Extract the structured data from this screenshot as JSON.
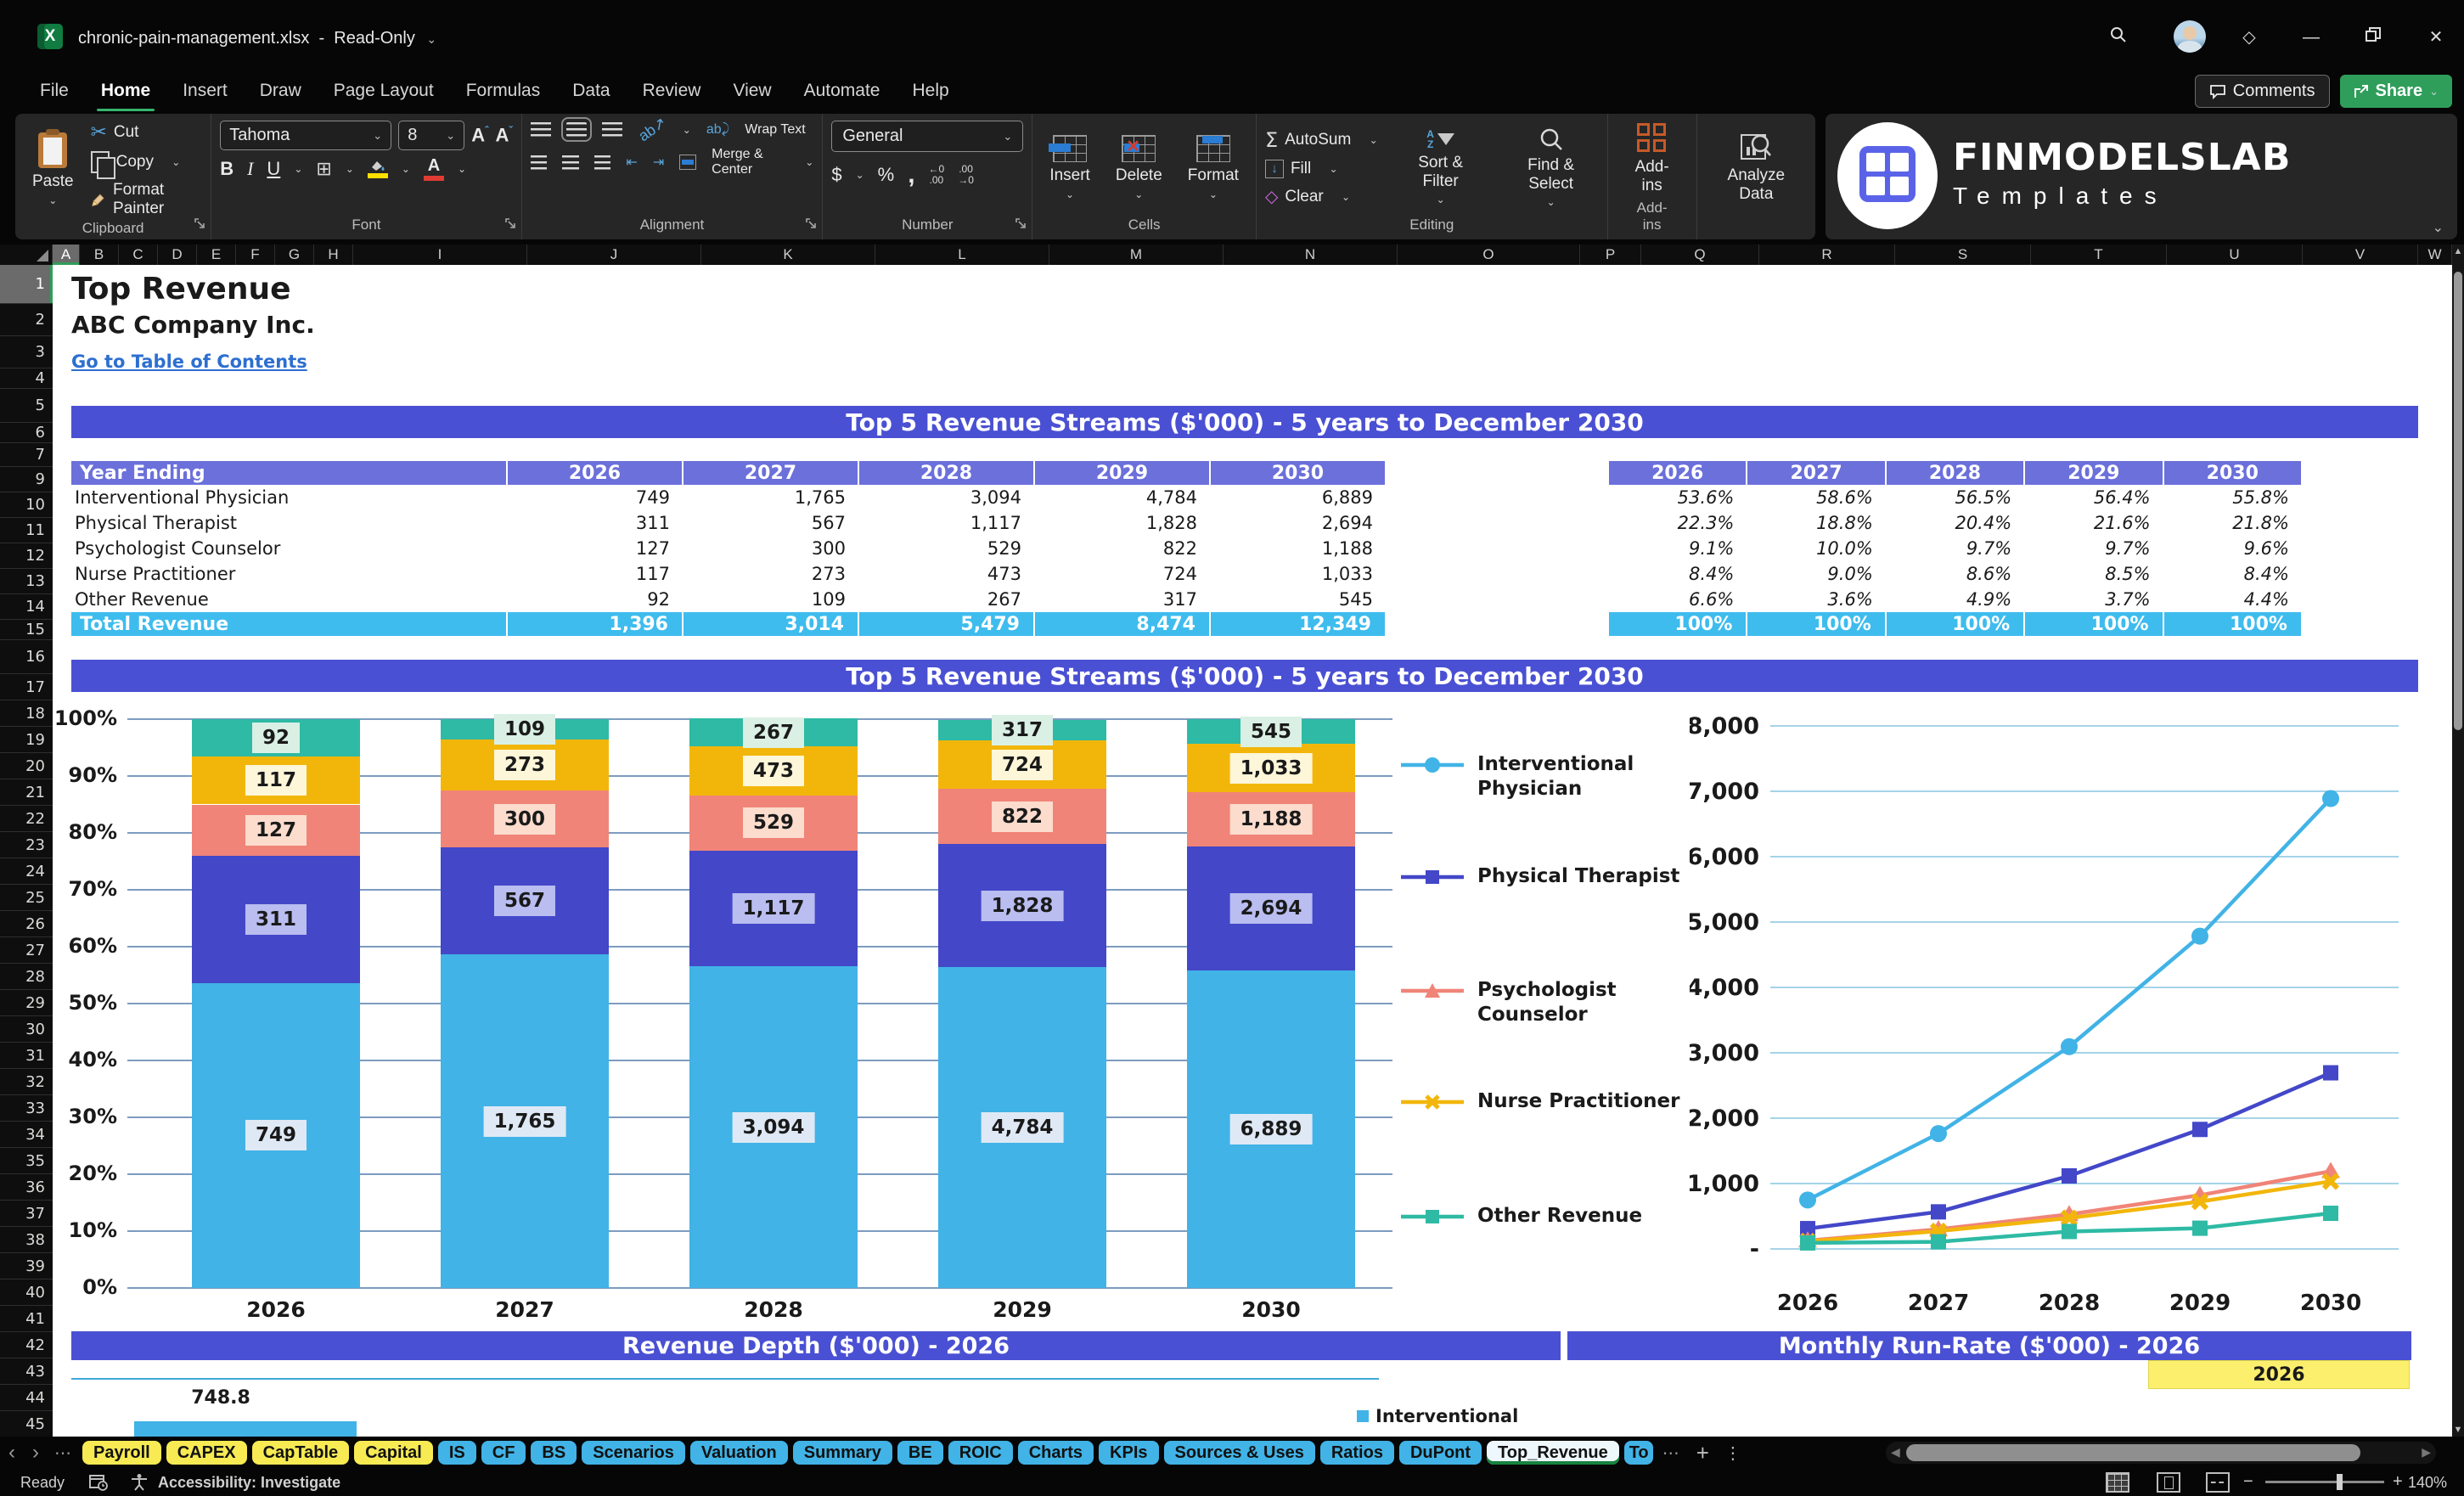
{
  "window": {
    "title": "chronic-pain-management.xlsx",
    "separator": "-",
    "mode": "Read-Only",
    "comments_label": "Comments",
    "share_label": "Share"
  },
  "ribbon": {
    "tabs": [
      "File",
      "Home",
      "Insert",
      "Draw",
      "Page Layout",
      "Formulas",
      "Data",
      "Review",
      "View",
      "Automate",
      "Help"
    ],
    "active_tab": "Home",
    "clipboard": {
      "paste": "Paste",
      "cut": "Cut",
      "copy": "Copy",
      "format_painter": "Format Painter",
      "label": "Clipboard"
    },
    "font": {
      "family": "Tahoma",
      "size": "8",
      "bold": "B",
      "italic": "I",
      "underline": "U",
      "label": "Font"
    },
    "alignment": {
      "wrap_text": "Wrap Text",
      "merge_center": "Merge & Center",
      "label": "Alignment"
    },
    "number": {
      "format": "General",
      "currency": "$",
      "percent": "%",
      "comma": ",",
      "label": "Number"
    },
    "cells": {
      "insert": "Insert",
      "delete": "Delete",
      "format": "Format",
      "label": "Cells"
    },
    "editing": {
      "autosum": "AutoSum",
      "fill": "Fill",
      "clear": "Clear",
      "sort_filter": "Sort & Filter",
      "find_select": "Find & Select",
      "label": "Editing"
    },
    "addins": {
      "label": "Add-ins"
    },
    "analyze": {
      "label": "Analyze Data"
    }
  },
  "logo": {
    "line1": "FINMODELSLAB",
    "line2": "Templates"
  },
  "grid": {
    "columns": [
      "A",
      "B",
      "C",
      "D",
      "E",
      "F",
      "G",
      "H",
      "I",
      "J",
      "K",
      "L",
      "M",
      "N",
      "O",
      "P",
      "Q",
      "R",
      "S",
      "T",
      "U",
      "V",
      "W"
    ],
    "selected_column": "A",
    "row_start": 1,
    "row_end": 45,
    "hidden_rows": [
      8
    ],
    "selected_row": 1
  },
  "sheet": {
    "title": "Top Revenue",
    "company": "ABC Company Inc.",
    "toc_link": "Go to Table of Contents",
    "section1_title": "Top 5 Revenue Streams ($'000) - 5 years to December 2030",
    "section2_title": "Top 5 Revenue Streams ($'000) - 5 years to December 2030",
    "section3_title": "Revenue Depth ($'000) - 2026",
    "section4_title": "Monthly Run-Rate ($'000) - 2026",
    "revenue_table": {
      "header": [
        "Year Ending",
        "2026",
        "2027",
        "2028",
        "2029",
        "2030"
      ],
      "rows": [
        {
          "name": "Interventional Physician",
          "values": [
            "749",
            "1,765",
            "3,094",
            "4,784",
            "6,889"
          ]
        },
        {
          "name": "Physical Therapist",
          "values": [
            "311",
            "567",
            "1,117",
            "1,828",
            "2,694"
          ]
        },
        {
          "name": "Psychologist Counselor",
          "values": [
            "127",
            "300",
            "529",
            "822",
            "1,188"
          ]
        },
        {
          "name": "Nurse Practitioner",
          "values": [
            "117",
            "273",
            "473",
            "724",
            "1,033"
          ]
        },
        {
          "name": "Other Revenue",
          "values": [
            "92",
            "109",
            "267",
            "317",
            "545"
          ]
        }
      ],
      "total": {
        "name": "Total Revenue",
        "values": [
          "1,396",
          "3,014",
          "5,479",
          "8,474",
          "12,349"
        ]
      }
    },
    "percent_table": {
      "header": [
        "2026",
        "2027",
        "2028",
        "2029",
        "2030"
      ],
      "rows": [
        [
          "53.6%",
          "58.6%",
          "56.5%",
          "56.4%",
          "55.8%"
        ],
        [
          "22.3%",
          "18.8%",
          "20.4%",
          "21.6%",
          "21.8%"
        ],
        [
          "9.1%",
          "10.0%",
          "9.7%",
          "9.7%",
          "9.6%"
        ],
        [
          "8.4%",
          "9.0%",
          "8.6%",
          "8.5%",
          "8.4%"
        ],
        [
          "6.6%",
          "3.6%",
          "4.9%",
          "3.7%",
          "4.4%"
        ]
      ],
      "total": [
        "100%",
        "100%",
        "100%",
        "100%",
        "100%"
      ]
    },
    "runrate_year_cell": "2026",
    "depth_label": "748.8",
    "depth_legend": "Interventional"
  },
  "chart_data": [
    {
      "type": "bar",
      "subtype": "percent-stacked-column",
      "title": "Top 5 Revenue Streams ($'000) - 5 years to December 2030",
      "categories": [
        "2026",
        "2027",
        "2028",
        "2029",
        "2030"
      ],
      "series": [
        {
          "name": "Interventional Physician",
          "color": "#41b3e6",
          "label_bg": "#dfe9f5",
          "values": [
            749,
            1765,
            3094,
            4784,
            6889
          ],
          "percent": [
            53.6,
            58.6,
            56.5,
            56.4,
            55.8
          ]
        },
        {
          "name": "Physical Therapist",
          "color": "#4347c8",
          "label_bg": "#b9bdf0",
          "values": [
            311,
            567,
            1117,
            1828,
            2694
          ],
          "percent": [
            22.3,
            18.8,
            20.4,
            21.6,
            21.8
          ]
        },
        {
          "name": "Psychologist Counselor",
          "color": "#f08478",
          "label_bg": "#fbdccd",
          "values": [
            127,
            300,
            529,
            822,
            1188
          ],
          "percent": [
            9.1,
            10.0,
            9.7,
            9.7,
            9.6
          ]
        },
        {
          "name": "Nurse Practitioner",
          "color": "#f2b60b",
          "label_bg": "#fdf6d8",
          "values": [
            117,
            273,
            473,
            724,
            1033
          ],
          "percent": [
            8.4,
            9.0,
            8.6,
            8.5,
            8.4
          ]
        },
        {
          "name": "Other Revenue",
          "color": "#2ebaa4",
          "label_bg": "#daf0e4",
          "values": [
            92,
            109,
            267,
            317,
            545
          ],
          "percent": [
            6.6,
            3.6,
            4.9,
            3.7,
            4.4
          ]
        }
      ],
      "y_axis": {
        "min": 0,
        "max": 100,
        "step": 10,
        "labels": [
          "0%",
          "10%",
          "20%",
          "30%",
          "40%",
          "50%",
          "60%",
          "70%",
          "80%",
          "90%",
          "100%"
        ]
      },
      "grid": true,
      "legend": "none"
    },
    {
      "type": "line",
      "categories": [
        "2026",
        "2027",
        "2028",
        "2029",
        "2030"
      ],
      "series": [
        {
          "name": "Interventional Physician",
          "color": "#41b3e6",
          "marker": "circle",
          "values": [
            749,
            1765,
            3094,
            4784,
            6889
          ]
        },
        {
          "name": "Physical Therapist",
          "color": "#4347c8",
          "marker": "square",
          "values": [
            311,
            567,
            1117,
            1828,
            2694
          ]
        },
        {
          "name": "Psychologist Counselor",
          "color": "#f08478",
          "marker": "triangle",
          "values": [
            127,
            300,
            529,
            822,
            1188
          ]
        },
        {
          "name": "Nurse Practitioner",
          "color": "#f2b60b",
          "marker": "x",
          "values": [
            117,
            273,
            473,
            724,
            1033
          ]
        },
        {
          "name": "Other Revenue",
          "color": "#2ebaa4",
          "marker": "square",
          "values": [
            92,
            109,
            267,
            317,
            545
          ]
        }
      ],
      "y_axis": {
        "min": 0,
        "max": 8000,
        "step": 1000,
        "labels": [
          "-",
          "1,000",
          "2,000",
          "3,000",
          "4,000",
          "5,000",
          "6,000",
          "7,000",
          "8,000"
        ]
      },
      "grid": true,
      "legend_position": "left"
    }
  ],
  "sheet_tabs": {
    "prev": "‹",
    "next": "›",
    "overflow": "⋯",
    "add_tab": "+",
    "more": "⋮",
    "tabs": [
      {
        "label": "Payroll",
        "color": "yellow"
      },
      {
        "label": "CAPEX",
        "color": "yellow"
      },
      {
        "label": "CapTable",
        "color": "yellow"
      },
      {
        "label": "Capital",
        "color": "yellow"
      },
      {
        "label": "IS",
        "color": "blue"
      },
      {
        "label": "CF",
        "color": "blue"
      },
      {
        "label": "BS",
        "color": "blue"
      },
      {
        "label": "Scenarios",
        "color": "blue"
      },
      {
        "label": "Valuation",
        "color": "blue"
      },
      {
        "label": "Summary",
        "color": "blue"
      },
      {
        "label": "BE",
        "color": "blue"
      },
      {
        "label": "ROIC",
        "color": "blue"
      },
      {
        "label": "Charts",
        "color": "blue"
      },
      {
        "label": "KPIs",
        "color": "blue"
      },
      {
        "label": "Sources & Uses",
        "color": "blue"
      },
      {
        "label": "Ratios",
        "color": "blue"
      },
      {
        "label": "DuPont",
        "color": "blue"
      },
      {
        "label": "Top_Revenue",
        "color": "active"
      },
      {
        "label": "To",
        "color": "blue",
        "clipped": true
      }
    ]
  },
  "status_bar": {
    "ready": "Ready",
    "accessibility": "Accessibility: Investigate",
    "zoom_level": "140%"
  }
}
